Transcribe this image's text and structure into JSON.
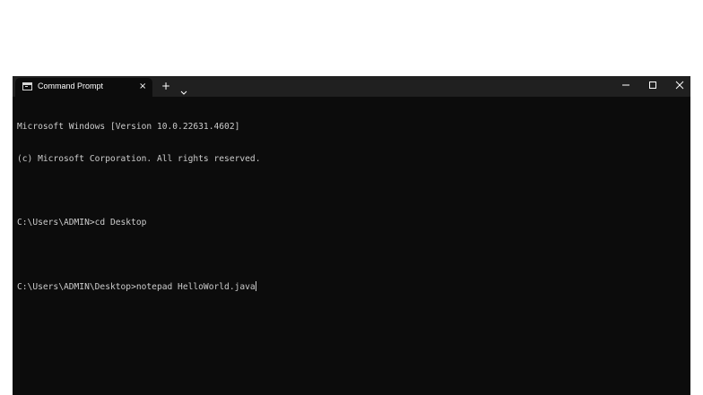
{
  "window": {
    "tab_title": "Command Prompt",
    "tab_close_label": "×",
    "new_tab_label": "+",
    "tab_icon": "terminal-icon",
    "dropdown_icon": "chevron-down-icon",
    "controls": [
      "minimize-icon",
      "maximize-icon",
      "close-icon"
    ]
  },
  "console": {
    "lines": [
      "Microsoft Windows [Version 10.0.22631.4602]",
      "(c) Microsoft Corporation. All rights reserved.",
      "",
      "C:\\Users\\ADMIN>cd Desktop",
      "",
      "C:\\Users\\ADMIN\\Desktop>notepad HelloWorld.java"
    ]
  },
  "colors": {
    "titlebar": "#202020",
    "tab": "#0c0c0c",
    "console_background": "#0c0c0c",
    "console_text": "#cccccc",
    "page_background": "#ffffff"
  }
}
